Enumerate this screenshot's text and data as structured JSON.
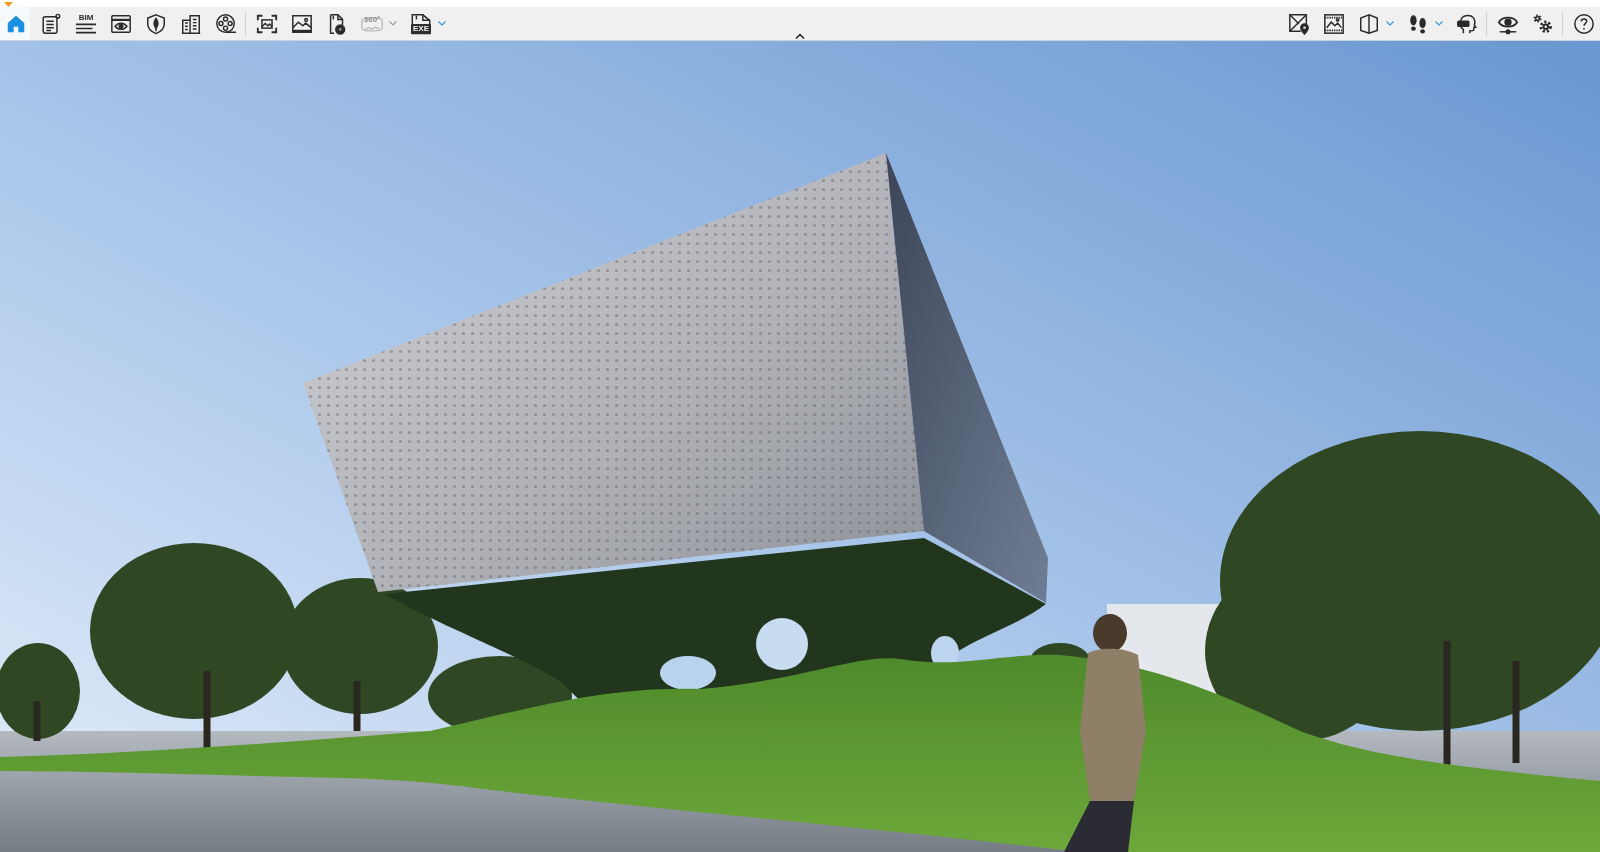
{
  "toolbar": {
    "expanded": true,
    "left_groups": [
      {
        "items": [
          {
            "kind": "home",
            "selected": true,
            "disabled": false,
            "dropdown": false
          },
          {
            "kind": "notes",
            "selected": false,
            "disabled": false,
            "dropdown": false
          },
          {
            "kind": "bim",
            "label": "BIM",
            "selected": false,
            "disabled": false,
            "dropdown": false
          },
          {
            "kind": "view",
            "selected": false,
            "disabled": false,
            "dropdown": false
          },
          {
            "kind": "shield",
            "selected": false,
            "disabled": false,
            "dropdown": false
          },
          {
            "kind": "building",
            "selected": false,
            "disabled": false,
            "dropdown": false
          },
          {
            "kind": "film",
            "selected": false,
            "disabled": false,
            "dropdown": false
          }
        ]
      },
      {
        "items": [
          {
            "kind": "screenshot",
            "selected": false,
            "disabled": false,
            "dropdown": false
          },
          {
            "kind": "image",
            "selected": false,
            "disabled": false,
            "dropdown": false
          },
          {
            "kind": "file-badge",
            "selected": false,
            "disabled": false,
            "dropdown": false
          },
          {
            "kind": "panorama-360",
            "label": "360°",
            "selected": false,
            "disabled": true,
            "dropdown": true
          },
          {
            "kind": "export",
            "label": "EXE",
            "selected": false,
            "disabled": false,
            "dropdown": true
          }
        ]
      }
    ],
    "right_groups": [
      {
        "items": [
          {
            "kind": "map",
            "selected": false,
            "disabled": false,
            "dropdown": false
          },
          {
            "kind": "panorama",
            "selected": false,
            "disabled": false,
            "dropdown": false
          },
          {
            "kind": "section",
            "selected": false,
            "disabled": false,
            "dropdown": true
          },
          {
            "kind": "walk",
            "selected": false,
            "disabled": false,
            "dropdown": true
          },
          {
            "kind": "vr",
            "selected": false,
            "disabled": false,
            "dropdown": false
          }
        ]
      },
      {
        "items": [
          {
            "kind": "visual",
            "selected": false,
            "disabled": false,
            "dropdown": false
          },
          {
            "kind": "settings",
            "selected": false,
            "disabled": false,
            "dropdown": false
          }
        ]
      },
      {
        "items": [
          {
            "kind": "help",
            "selected": false,
            "disabled": false,
            "dropdown": false
          }
        ]
      }
    ]
  }
}
